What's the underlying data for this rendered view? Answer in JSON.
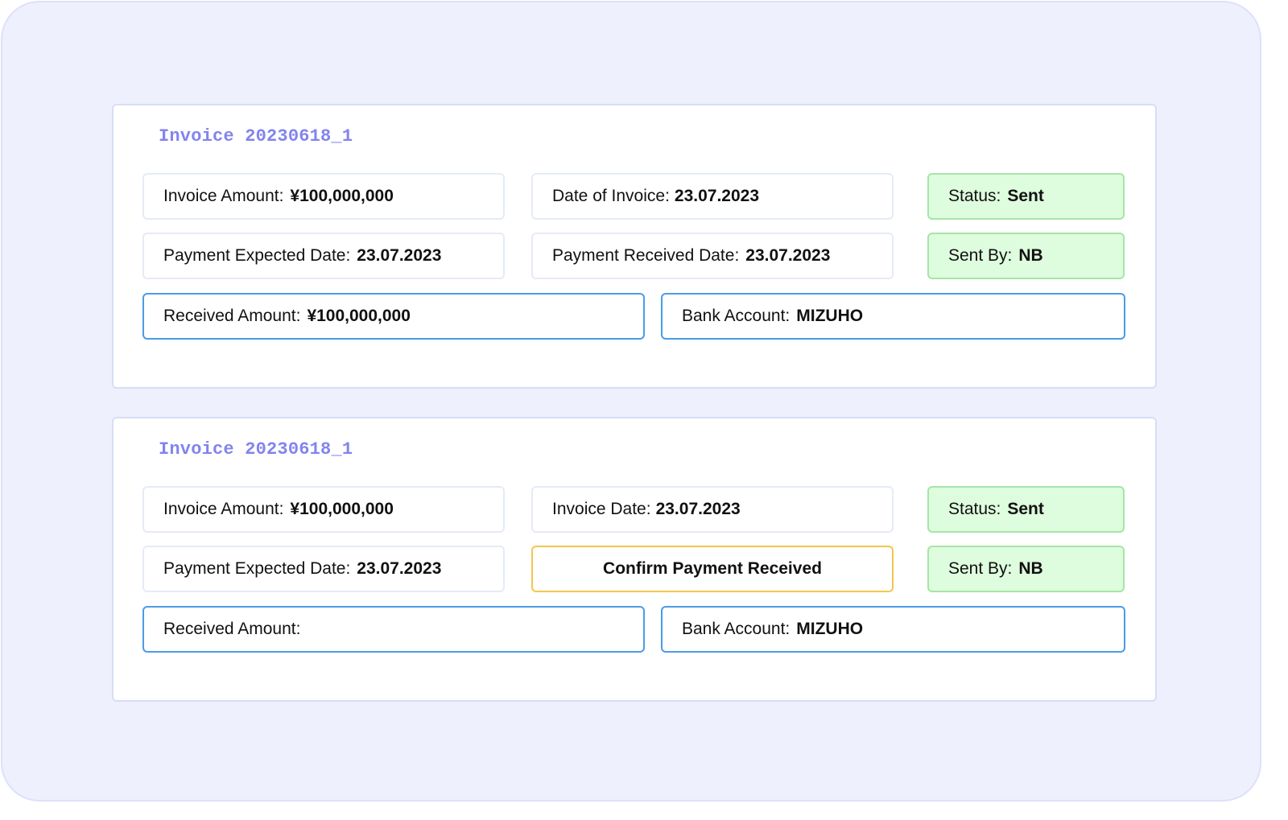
{
  "cards": [
    {
      "title": "Invoice 20230618_1",
      "invoice_amount_label": "Invoice Amount:",
      "invoice_amount_value": "¥100,000,000",
      "date_label": "Date of Invoice:",
      "date_value": "23.07.2023",
      "status_label": "Status:",
      "status_value": "Sent",
      "payment_expected_label": "Payment Expected Date:",
      "payment_expected_value": "23.07.2023",
      "payment_received_label": "Payment Received Date:",
      "payment_received_value": "23.07.2023",
      "sent_by_label": "Sent By:",
      "sent_by_value": "NB",
      "received_amount_label": "Received Amount:",
      "received_amount_value": "¥100,000,000",
      "bank_account_label": "Bank Account:",
      "bank_account_value": "MIZUHO"
    },
    {
      "title": "Invoice 20230618_1",
      "invoice_amount_label": "Invoice Amount:",
      "invoice_amount_value": "¥100,000,000",
      "date_label": "Invoice Date:",
      "date_value": "23.07.2023",
      "status_label": "Status:",
      "status_value": "Sent",
      "payment_expected_label": "Payment Expected Date:",
      "payment_expected_value": "23.07.2023",
      "confirm_button_label": "Confirm Payment Received",
      "sent_by_label": "Sent By:",
      "sent_by_value": "NB",
      "received_amount_label": "Received Amount:",
      "received_amount_value": "",
      "bank_account_label": "Bank Account:",
      "bank_account_value": "MIZUHO"
    }
  ],
  "colors": {
    "background": "#eef0fd",
    "title": "#8284ee",
    "status_green": "#defcde",
    "input_blue": "#4a9ce6",
    "action_yellow": "#f3c64c"
  }
}
